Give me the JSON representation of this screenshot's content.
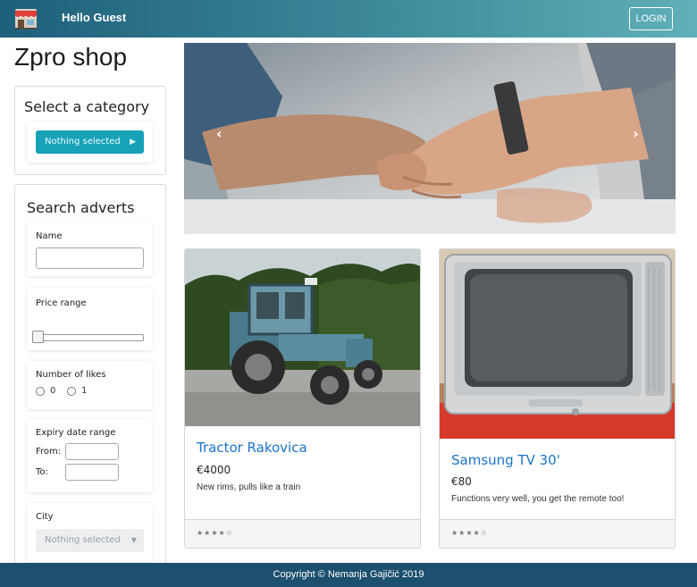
{
  "navbar": {
    "logo_icon": "shop-icon",
    "greeting": "Hello Guest",
    "login_label": "LOGIN"
  },
  "sidebar": {
    "shop_title": "Zpro shop",
    "category": {
      "title": "Select a category",
      "select_value": "Nothing selected",
      "select_icon": "chevron-right-icon"
    },
    "search": {
      "title": "Search adverts",
      "name_label": "Name",
      "name_value": "",
      "price_label": "Price range",
      "price_slider_value": 0,
      "likes_label": "Number of likes",
      "likes_options": [
        "0",
        "1"
      ],
      "expiry_label": "Expiry date range",
      "from_label": "From:",
      "to_label": "To:",
      "from_value": "",
      "to_value": "",
      "city_label": "City",
      "city_value": "Nothing selected",
      "city_icon": "caret-down-icon"
    }
  },
  "carousel": {
    "image_icon": "handshake-image",
    "prev_icon": "chevron-left-icon",
    "next_icon": "chevron-right-icon",
    "slide_count": 3,
    "active_slide": 2
  },
  "products": [
    {
      "title": "Tractor Rakovica",
      "price": "€4000",
      "description": "New rims, pulls like a train",
      "rating_stars": "★★★★☆",
      "image_icon": "tractor-image"
    },
    {
      "title": "Samsung TV 30'",
      "price": "€80",
      "description": "Functions very well, you get the remote too!",
      "rating_stars": "★★★★☆",
      "image_icon": "tv-image"
    }
  ],
  "footer": {
    "copyright": "Copyright © Nemanja Gajičić 2019"
  },
  "colors": {
    "navbar_start": "#1e5f7a",
    "navbar_end": "#5fb0b8",
    "accent": "#17a2b8",
    "link": "#1a73c9",
    "footer": "#1d4f6e"
  }
}
